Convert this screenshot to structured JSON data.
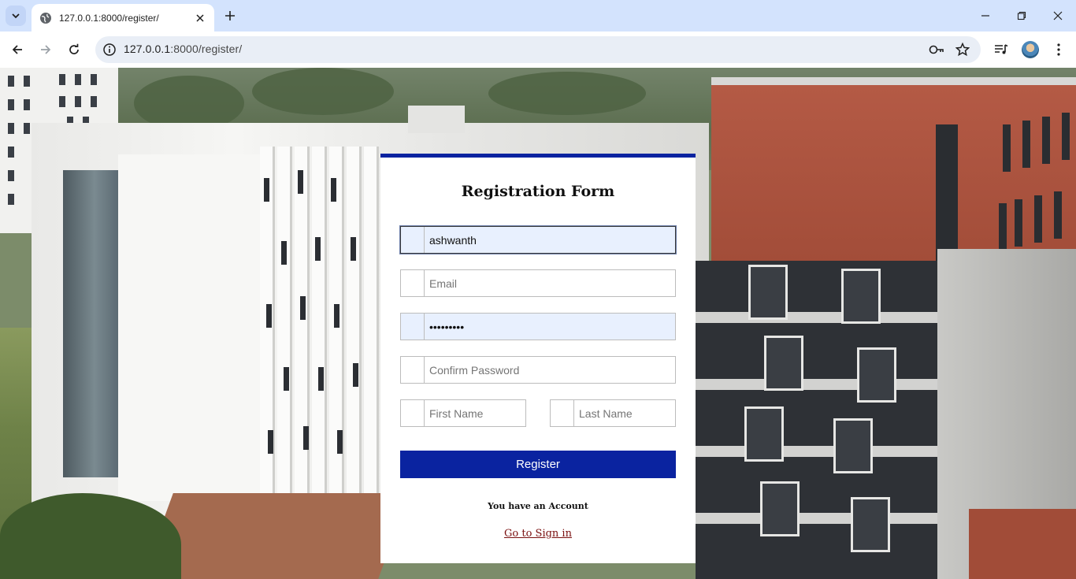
{
  "browser": {
    "tab_title": "127.0.0.1:8000/register/",
    "url_host": "127.0.0.1",
    "url_rest": ":8000/register/"
  },
  "form": {
    "title": "Registration Form",
    "username": {
      "value": "ashwanth",
      "placeholder": ""
    },
    "email": {
      "value": "",
      "placeholder": "Email"
    },
    "password": {
      "value": "ashwanth1",
      "placeholder": ""
    },
    "confirm_password": {
      "value": "",
      "placeholder": "Confirm Password"
    },
    "first_name": {
      "value": "",
      "placeholder": "First Name"
    },
    "last_name": {
      "value": "",
      "placeholder": "Last Name"
    },
    "register_label": "Register",
    "have_account_text": "You have an Account",
    "signin_link_text": "Go to Sign in"
  },
  "colors": {
    "accent": "#0a23a0",
    "link": "#7a1010",
    "autofill": "#e8f0fe",
    "tabstrip": "#d3e3fd"
  },
  "icons": [
    "tab-search-icon",
    "globe-icon",
    "close-icon",
    "plus-icon",
    "minimize-icon",
    "restore-icon",
    "window-close-icon",
    "back-arrow-icon",
    "forward-arrow-icon",
    "reload-icon",
    "info-icon",
    "key-icon",
    "star-icon",
    "media-icon",
    "kebab-menu-icon"
  ]
}
